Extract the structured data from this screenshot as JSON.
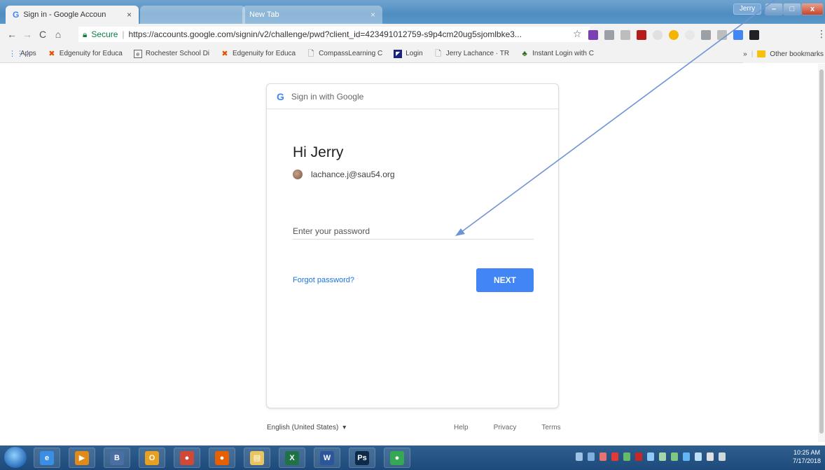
{
  "browser": {
    "tabs": [
      {
        "title": "Sign in - Google Accoun",
        "close": "×"
      },
      {
        "title": "",
        "close": ""
      },
      {
        "title": "New Tab",
        "close": "×"
      }
    ],
    "profile_name": "Jerry",
    "window_buttons": {
      "minimize": "–",
      "maximize": "□",
      "close": "x"
    },
    "nav": {
      "back": "←",
      "forward": "→",
      "reload": "C",
      "home": "⌂"
    },
    "omnibox": {
      "secure_label": "Secure",
      "url": "https://accounts.google.com/signin/v2/challenge/pwd?client_id=423491012759-s9p4cm20ug5sjomlbke3..."
    },
    "bookmarks": [
      {
        "label": "Apps",
        "icon": "apps-grid-icon"
      },
      {
        "label": "Edgenuity for Educa",
        "icon": "edgenuity-icon"
      },
      {
        "label": "Rochester School Di",
        "icon": "school-icon"
      },
      {
        "label": "Edgenuity for Educa",
        "icon": "edgenuity-icon"
      },
      {
        "label": "CompassLearning C",
        "icon": "page-icon"
      },
      {
        "label": "Login",
        "icon": "login-icon"
      },
      {
        "label": "Jerry Lachance · TR",
        "icon": "page-icon"
      },
      {
        "label": "Instant Login with C",
        "icon": "instant-login-icon"
      }
    ],
    "bookmarks_overflow": "»",
    "other_bookmarks": "Other bookmarks"
  },
  "signin": {
    "header": "Sign in with Google",
    "greeting": "Hi Jerry",
    "email": "lachance.j@sau54.org",
    "password_placeholder": "Enter your password",
    "forgot_link": "Forgot password?",
    "next_button": "NEXT"
  },
  "footer": {
    "language": "English (United States)",
    "language_caret": "▾",
    "help": "Help",
    "privacy": "Privacy",
    "terms": "Terms"
  },
  "taskbar": {
    "clock_time": "10:25 AM",
    "clock_date": "7/17/2018",
    "apps": [
      {
        "name": "internet-explorer",
        "glyph": "e",
        "color": "#3a8ee6"
      },
      {
        "name": "media-player",
        "glyph": "▶",
        "color": "#e08a1a"
      },
      {
        "name": "app-b",
        "glyph": "B",
        "color": "#4a6fa5"
      },
      {
        "name": "outlook",
        "glyph": "O",
        "color": "#e8a020"
      },
      {
        "name": "chrome-alt",
        "glyph": "●",
        "color": "#d14836"
      },
      {
        "name": "firefox",
        "glyph": "●",
        "color": "#e66000"
      },
      {
        "name": "file-explorer",
        "glyph": "▤",
        "color": "#e8c560"
      },
      {
        "name": "excel",
        "glyph": "X",
        "color": "#1f7244"
      },
      {
        "name": "word",
        "glyph": "W",
        "color": "#2b579a"
      },
      {
        "name": "photoshop",
        "glyph": "Ps",
        "color": "#0d2a4a"
      },
      {
        "name": "chrome",
        "glyph": "●",
        "color": "#34a853"
      }
    ]
  },
  "colors": {
    "accent": "#4285f4",
    "link": "#1a73e8",
    "annotation_arrow": "#6f94d6"
  }
}
